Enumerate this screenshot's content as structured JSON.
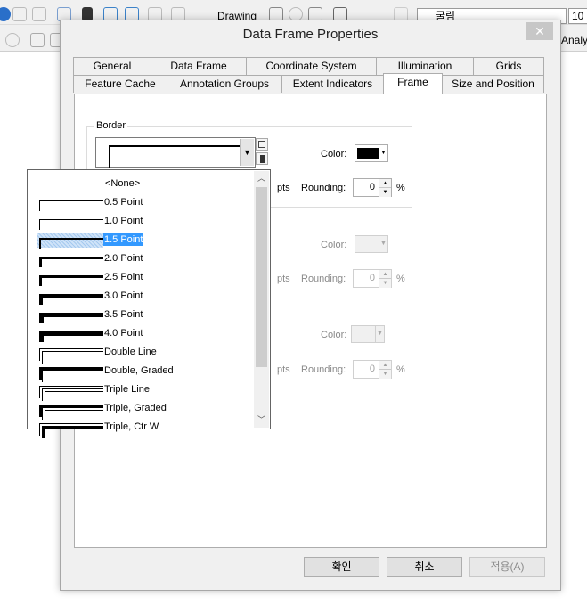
{
  "app": {
    "toolbar": {
      "drawing_label": "Drawing",
      "font_name": "굴림",
      "font_size": "10",
      "analysis_label": "Analy"
    }
  },
  "dialog": {
    "title": "Data Frame Properties",
    "close_label": "✕",
    "tabs_row1": [
      {
        "label": "General"
      },
      {
        "label": "Data Frame"
      },
      {
        "label": "Coordinate System"
      },
      {
        "label": "Illumination"
      },
      {
        "label": "Grids"
      }
    ],
    "tabs_row2": [
      {
        "label": "Feature Cache"
      },
      {
        "label": "Annotation Groups"
      },
      {
        "label": "Extent Indicators"
      },
      {
        "label": "Frame",
        "active": true
      },
      {
        "label": "Size and Position"
      }
    ],
    "border": {
      "group_label": "Border",
      "color_label": "Color:",
      "color_value": "#000000",
      "gap_unit": "pts",
      "rounding_label": "Rounding:",
      "rounding_value": "0",
      "rounding_unit": "%"
    },
    "background": {
      "color_label": "Color:",
      "gap_unit": "pts",
      "rounding_label": "Rounding:",
      "rounding_value": "0",
      "rounding_unit": "%"
    },
    "drop_shadow": {
      "color_label": "Color:",
      "gap_unit": "pts",
      "rounding_label": "Rounding:",
      "rounding_value": "0",
      "rounding_unit": "%"
    },
    "border_dropdown": {
      "selected": "1.5 Point",
      "options": [
        {
          "label": "<None>",
          "style": "none"
        },
        {
          "label": "0.5 Point",
          "style": "single",
          "weight": 0.5
        },
        {
          "label": "1.0 Point",
          "style": "single",
          "weight": 1
        },
        {
          "label": "1.5 Point",
          "style": "single",
          "weight": 1.5
        },
        {
          "label": "2.0 Point",
          "style": "single",
          "weight": 2
        },
        {
          "label": "2.5 Point",
          "style": "single",
          "weight": 2.5
        },
        {
          "label": "3.0 Point",
          "style": "single",
          "weight": 3
        },
        {
          "label": "3.5 Point",
          "style": "single",
          "weight": 3.5
        },
        {
          "label": "4.0 Point",
          "style": "single",
          "weight": 4
        },
        {
          "label": "Double Line",
          "style": "double"
        },
        {
          "label": "Double, Graded",
          "style": "double-graded"
        },
        {
          "label": "Triple Line",
          "style": "triple"
        },
        {
          "label": "Triple, Graded",
          "style": "triple-graded"
        },
        {
          "label": "Triple, Ctr W",
          "style": "triple-ctr"
        }
      ]
    },
    "buttons": {
      "ok": "확인",
      "cancel": "취소",
      "apply": "적용(A)"
    }
  }
}
